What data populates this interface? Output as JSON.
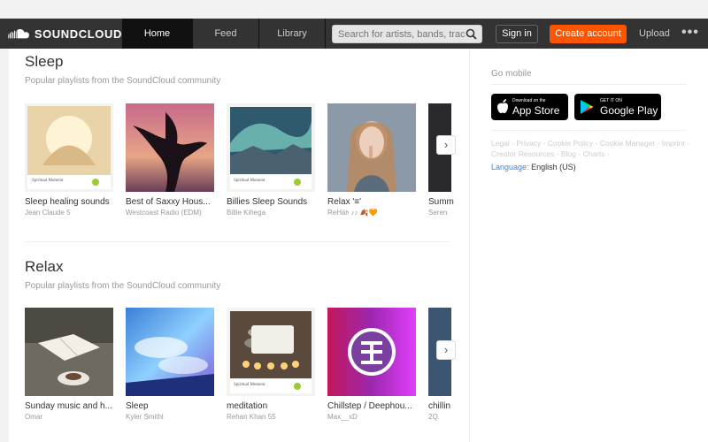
{
  "header": {
    "brand": "SOUNDCLOUD",
    "tabs": [
      {
        "label": "Home",
        "active": true
      },
      {
        "label": "Feed",
        "active": false
      },
      {
        "label": "Library",
        "active": false
      }
    ],
    "search_placeholder": "Search for artists, bands, tracks, podcasts",
    "signin_label": "Sign in",
    "create_label": "Create account",
    "upload_label": "Upload",
    "more_label": "•••",
    "accent_color": "#ff5500"
  },
  "sections": [
    {
      "title": "Sleep",
      "subtitle": "Popular playlists from the SoundCloud community",
      "cards": [
        {
          "title": "Sleep healing sounds",
          "user": "Jean Claude 5",
          "art_label": "Spiritual Moment"
        },
        {
          "title": "Best of Saxxy Hous...",
          "user": "Westcoast Radio (EDM)",
          "art_label": ""
        },
        {
          "title": "Billies Sleep Sounds",
          "user": "Billie Kihega",
          "art_label": "Spiritual Moment"
        },
        {
          "title": "Relax '≡'",
          "user": "ReHä𝔡 ♪♪ 🍂🧡",
          "art_label": ""
        },
        {
          "title": "Summ",
          "user": "Seren",
          "art_label": ""
        }
      ]
    },
    {
      "title": "Relax",
      "subtitle": "Popular playlists from the SoundCloud community",
      "cards": [
        {
          "title": "Sunday music and h...",
          "user": "Omar",
          "art_label": ""
        },
        {
          "title": "Sleep",
          "user": "Kyler Smithl",
          "art_label": ""
        },
        {
          "title": "meditation",
          "user": "Rehan Khan 55",
          "art_label": "Spiritual Moment"
        },
        {
          "title": "Chillstep / Deephou...",
          "user": "Max__xD",
          "art_label": ""
        },
        {
          "title": "chillin",
          "user": "2Q.",
          "art_label": ""
        }
      ]
    }
  ],
  "sidebar": {
    "title": "Go mobile",
    "app_store": {
      "small": "Download on the",
      "big": "App Store"
    },
    "google_play": {
      "small": "GET IT ON",
      "big": "Google Play"
    },
    "links": "Legal - Privacy - Cookie Policy - Cookie Manager - Imprint - Creator Resources - Blog - Charts -",
    "language_label": "Language:",
    "language_value": "English (US)"
  }
}
